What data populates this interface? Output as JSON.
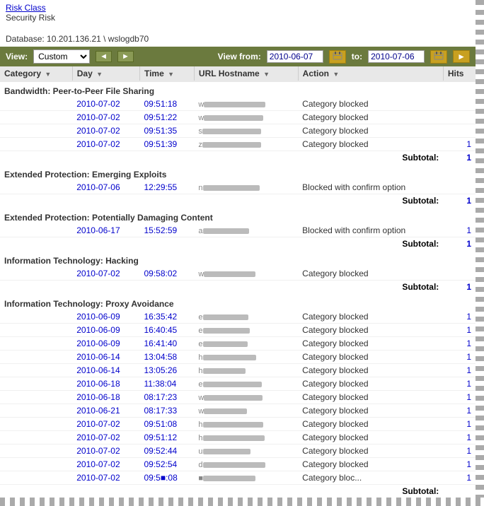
{
  "header": {
    "risk_class_link": "Risk Class",
    "page_title": "Security Risk",
    "database_label": "Database:",
    "database_value": "10.201.136.21 \\ wslogdb70"
  },
  "toolbar": {
    "view_label": "View:",
    "view_value": "Custom",
    "nav_back": "◄",
    "nav_forward": "►",
    "view_from_label": "View from:",
    "date_from": "2010-06-07",
    "to_label": "to:",
    "date_to": "2010-07-06",
    "go_label": "►"
  },
  "table": {
    "columns": [
      "Category",
      "Day",
      "Time",
      "URL Hostname",
      "Action",
      "Hits"
    ],
    "sections": [
      {
        "name": "Bandwidth: Peer-to-Peer File Sharing",
        "rows": [
          {
            "day": "2010-07-02",
            "time": "09:51:18",
            "url": "w■■■■■■■■■■■ ■■■",
            "action": "Category blocked",
            "hits": ""
          },
          {
            "day": "2010-07-02",
            "time": "09:51:22",
            "url": "w■■■■■■■■■■■ ■■■■■■",
            "action": "Category blocked",
            "hits": ""
          },
          {
            "day": "2010-07-02",
            "time": "09:51:35",
            "url": "sl■■■■■■■■■■ ■■■",
            "action": "Category blocked",
            "hits": ""
          },
          {
            "day": "2010-07-02",
            "time": "09:51:39",
            "url": "ze■■■■■■■■■■ ■■■",
            "action": "Category blocked",
            "hits": "1"
          }
        ],
        "subtotal": "1"
      },
      {
        "name": "Extended Protection: Emerging Exploits",
        "rows": [
          {
            "day": "2010-07-06",
            "time": "12:29:55",
            "url": "no■■■■■■■■■■■■■■■",
            "action": "Blocked with confirm option",
            "hits": ""
          }
        ],
        "subtotal": "1"
      },
      {
        "name": "Extended Protection: Potentially Damaging Content",
        "rows": [
          {
            "day": "2010-06-17",
            "time": "15:52:59",
            "url": "a■■■■■■■■■■■■■■■■",
            "action": "Blocked with confirm option",
            "hits": "1"
          }
        ],
        "subtotal": "1"
      },
      {
        "name": "Information Technology: Hacking",
        "rows": [
          {
            "day": "2010-07-02",
            "time": "09:58:02",
            "url": "wv■■■■■■■■■■",
            "action": "Category blocked",
            "hits": ""
          }
        ],
        "subtotal": "1"
      },
      {
        "name": "Information Technology: Proxy Avoidance",
        "rows": [
          {
            "day": "2010-06-09",
            "time": "16:35:42",
            "url": "e■■ ■■■■■■■■■■■■■■■■",
            "action": "Category blocked",
            "hits": "1"
          },
          {
            "day": "2010-06-09",
            "time": "16:40:45",
            "url": "e■■ ■■■■■■■■■■■■■■■■",
            "action": "Category blocked",
            "hits": "1"
          },
          {
            "day": "2010-06-09",
            "time": "16:41:40",
            "url": "e■■ ■■■■■■■■■■■■■■■■",
            "action": "Category blocked",
            "hits": "1"
          },
          {
            "day": "2010-06-14",
            "time": "13:04:58",
            "url": "h■■■■■■■■ ■■■■■",
            "action": "Category blocked",
            "hits": "1"
          },
          {
            "day": "2010-06-14",
            "time": "13:05:26",
            "url": "h■■■■■■■■ ■■■■■",
            "action": "Category blocked",
            "hits": "1"
          },
          {
            "day": "2010-06-18",
            "time": "11:38:04",
            "url": "e■■ ■■■■■■■■■■■■■■■■",
            "action": "Category blocked",
            "hits": "1"
          },
          {
            "day": "2010-06-18",
            "time": "08:17:23",
            "url": "w■■■■■■■■■■■■■■■■■■",
            "action": "Category blocked",
            "hits": "1"
          },
          {
            "day": "2010-06-21",
            "time": "08:17:33",
            "url": "w■■■■■■■■■■■■■■■■■■",
            "action": "Category blocked",
            "hits": "1"
          },
          {
            "day": "2010-07-02",
            "time": "09:51:08",
            "url": "h■■■■■■ ■■■■■■■■■",
            "action": "Category blocked",
            "hits": "1"
          },
          {
            "day": "2010-07-02",
            "time": "09:51:12",
            "url": "h■■■■■■ ■■■■■■■■■",
            "action": "Category blocked",
            "hits": "1"
          },
          {
            "day": "2010-07-02",
            "time": "09:52:44",
            "url": "u■■■■■■■■■■■■■■■■■■",
            "action": "Category blocked",
            "hits": "1"
          },
          {
            "day": "2010-07-02",
            "time": "09:52:54",
            "url": "d■■■■■■■■■■■",
            "action": "Category blocked",
            "hits": "1"
          },
          {
            "day": "2010-07-02",
            "time": "09:5■:08",
            "url": "■■■■■■■■■■■■■■■■■■",
            "action": "Category bloc...",
            "hits": "1"
          }
        ],
        "subtotal": ""
      }
    ]
  }
}
